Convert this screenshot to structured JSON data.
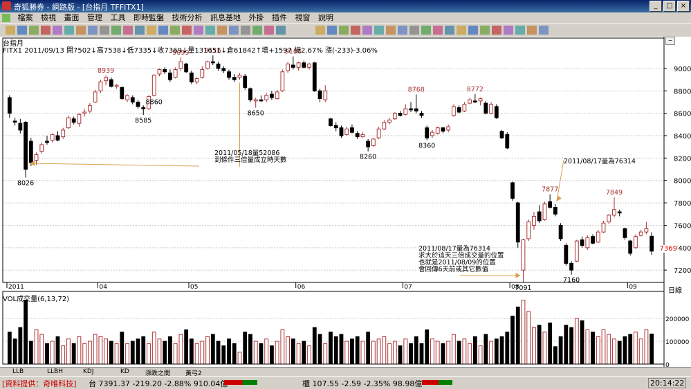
{
  "window": {
    "title": "奇狐勝券 - 網路版 - [台指月 TFFITX1]",
    "controls": [
      "_",
      "□",
      "×"
    ]
  },
  "menu": [
    "檔案",
    "檢視",
    "畫面",
    "管理",
    "工具",
    "即時監盤",
    "技術分析",
    "訊息基地",
    "外掛",
    "插件",
    "視窗",
    "說明"
  ],
  "chart_header": {
    "title": "台指月",
    "info": "FITX1 2011/09/13 開7502↓高7538↓低7335↓收7369↓量131651↓倉61842↑增+1597 振2.67% 漲(-233)-3.06%"
  },
  "price_axis": {
    "ticks": [
      9000,
      8800,
      8600,
      8400,
      8200,
      8000,
      7800,
      7600,
      7400,
      7200
    ],
    "current_label": "7369",
    "unit_label": "日線"
  },
  "x_axis": {
    "labels": [
      {
        "idx": 0,
        "text": "2011"
      },
      {
        "idx": 17,
        "text": "04"
      },
      {
        "idx": 34,
        "text": "05"
      },
      {
        "idx": 54,
        "text": "06"
      },
      {
        "idx": 74,
        "text": "07"
      },
      {
        "idx": 94,
        "text": "08"
      },
      {
        "idx": 116,
        "text": "09"
      }
    ]
  },
  "volume_panel": {
    "legend": "VOL成交量(6,13,72)",
    "ticks": [
      {
        "value": 200000,
        "label": "200000"
      },
      {
        "value": 100000,
        "label": "100000"
      },
      {
        "value": 0,
        "label": "0"
      }
    ]
  },
  "indicator_tabs": [
    "LLB",
    "LLBH",
    "KDJ",
    "KD",
    "漲跌之間",
    "黃弓2"
  ],
  "status_bar": {
    "provider": "[資料提供：奇唯科技]",
    "taiex": "台 7391.37 -219.20 -2.88% 910.04億",
    "otc": "櫃 107.55 -2.59 -2.35% 98.98億",
    "time": "20:14:22",
    "up_color": "#cc0000",
    "down_color": "#008000"
  },
  "annotations": {
    "note1": [
      "2011/05/18量52086",
      "到條件三倍量成立時天數"
    ],
    "note2": "2011/08/17量為76314",
    "note3": [
      "2011/08/17量為76314",
      "求大於這天三倍成交量的位置",
      "也就是2011/08/09的位置",
      "會回傳6天前或其它數值"
    ]
  },
  "chart_data": {
    "type": "candlestick",
    "title": "台指月",
    "ylim": [
      7090,
      9160
    ],
    "volume_ylim": [
      0,
      300000
    ],
    "up_color": "#aa3333",
    "down_color": "#000000",
    "candles": [
      {
        "o": 8740,
        "h": 8760,
        "l": 8560,
        "c": 8600,
        "v": 140000
      },
      {
        "o": 8530,
        "h": 8560,
        "l": 8490,
        "c": 8520,
        "v": 110000
      },
      {
        "o": 8510,
        "h": 8550,
        "l": 8420,
        "c": 8450,
        "v": 160000
      },
      {
        "o": 8520,
        "h": 8530,
        "l": 8026,
        "c": 8100,
        "v": 280000
      },
      {
        "o": 8350,
        "h": 8380,
        "l": 8130,
        "c": 8160,
        "v": 100000
      },
      {
        "o": 8180,
        "h": 8250,
        "l": 8140,
        "c": 8230,
        "v": 150000
      },
      {
        "o": 8260,
        "h": 8340,
        "l": 8240,
        "c": 8320,
        "v": 130000
      },
      {
        "o": 8350,
        "h": 8400,
        "l": 8320,
        "c": 8340,
        "v": 90000
      },
      {
        "o": 8360,
        "h": 8420,
        "l": 8340,
        "c": 8410,
        "v": 100000
      },
      {
        "o": 8400,
        "h": 8440,
        "l": 8350,
        "c": 8360,
        "v": 120000
      },
      {
        "o": 8390,
        "h": 8470,
        "l": 8370,
        "c": 8450,
        "v": 80000
      },
      {
        "o": 8470,
        "h": 8580,
        "l": 8460,
        "c": 8560,
        "v": 110000
      },
      {
        "o": 8550,
        "h": 8570,
        "l": 8500,
        "c": 8520,
        "v": 90000
      },
      {
        "o": 8510,
        "h": 8600,
        "l": 8480,
        "c": 8590,
        "v": 120000
      },
      {
        "o": 8600,
        "h": 8640,
        "l": 8570,
        "c": 8610,
        "v": 90000
      },
      {
        "o": 8620,
        "h": 8690,
        "l": 8600,
        "c": 8670,
        "v": 100000
      },
      {
        "o": 8700,
        "h": 8810,
        "l": 8690,
        "c": 8790,
        "v": 130000
      },
      {
        "o": 8800,
        "h": 8900,
        "l": 8780,
        "c": 8880,
        "v": 120000
      },
      {
        "o": 8890,
        "h": 8939,
        "l": 8850,
        "c": 8920,
        "v": 110000
      },
      {
        "o": 8900,
        "h": 8920,
        "l": 8830,
        "c": 8840,
        "v": 100000
      },
      {
        "o": 8840,
        "h": 8860,
        "l": 8820,
        "c": 8850,
        "v": 90000
      },
      {
        "o": 8830,
        "h": 8840,
        "l": 8720,
        "c": 8730,
        "v": 140000
      },
      {
        "o": 8720,
        "h": 8770,
        "l": 8700,
        "c": 8760,
        "v": 90000
      },
      {
        "o": 8740,
        "h": 8760,
        "l": 8680,
        "c": 8700,
        "v": 100000
      },
      {
        "o": 8700,
        "h": 8720,
        "l": 8640,
        "c": 8660,
        "v": 110000
      },
      {
        "o": 8650,
        "h": 8670,
        "l": 8585,
        "c": 8640,
        "v": 120000
      },
      {
        "o": 8640,
        "h": 8760,
        "l": 8630,
        "c": 8750,
        "v": 90000
      },
      {
        "o": 8760,
        "h": 8950,
        "l": 8750,
        "c": 8940,
        "v": 140000
      },
      {
        "o": 8950,
        "h": 9000,
        "l": 8930,
        "c": 8990,
        "v": 110000
      },
      {
        "o": 8990,
        "h": 9010,
        "l": 8950,
        "c": 8970,
        "v": 100000
      },
      {
        "o": 8960,
        "h": 8990,
        "l": 8880,
        "c": 8900,
        "v": 120000
      },
      {
        "o": 8920,
        "h": 9010,
        "l": 8910,
        "c": 8990,
        "v": 90000
      },
      {
        "o": 9000,
        "h": 9099,
        "l": 8980,
        "c": 9060,
        "v": 130000
      },
      {
        "o": 9040,
        "h": 9050,
        "l": 8960,
        "c": 8970,
        "v": 150000
      },
      {
        "o": 8960,
        "h": 8980,
        "l": 8860,
        "c": 8880,
        "v": 110000
      },
      {
        "o": 8880,
        "h": 8920,
        "l": 8860,
        "c": 8910,
        "v": 90000
      },
      {
        "o": 8920,
        "h": 9020,
        "l": 8910,
        "c": 8990,
        "v": 100000
      },
      {
        "o": 9000,
        "h": 9070,
        "l": 8990,
        "c": 9060,
        "v": 120000
      },
      {
        "o": 9060,
        "h": 9116,
        "l": 9030,
        "c": 9050,
        "v": 130000
      },
      {
        "o": 9040,
        "h": 9060,
        "l": 8980,
        "c": 9000,
        "v": 100000
      },
      {
        "o": 9000,
        "h": 9020,
        "l": 8960,
        "c": 8980,
        "v": 80000
      },
      {
        "o": 8970,
        "h": 8990,
        "l": 8900,
        "c": 8920,
        "v": 110000
      },
      {
        "o": 8920,
        "h": 8950,
        "l": 8880,
        "c": 8900,
        "v": 90000
      },
      {
        "o": 8920,
        "h": 8960,
        "l": 8900,
        "c": 8940,
        "v": 52086
      },
      {
        "o": 8930,
        "h": 8950,
        "l": 8810,
        "c": 8830,
        "v": 140000
      },
      {
        "o": 8820,
        "h": 8830,
        "l": 8700,
        "c": 8720,
        "v": 130000
      },
      {
        "o": 8710,
        "h": 8740,
        "l": 8650,
        "c": 8720,
        "v": 100000
      },
      {
        "o": 8720,
        "h": 8760,
        "l": 8700,
        "c": 8710,
        "v": 90000
      },
      {
        "o": 8720,
        "h": 8780,
        "l": 8700,
        "c": 8760,
        "v": 110000
      },
      {
        "o": 8770,
        "h": 8800,
        "l": 8720,
        "c": 8740,
        "v": 80000
      },
      {
        "o": 8730,
        "h": 8810,
        "l": 8720,
        "c": 8790,
        "v": 100000
      },
      {
        "o": 8800,
        "h": 8990,
        "l": 8790,
        "c": 8970,
        "v": 150000
      },
      {
        "o": 8980,
        "h": 9060,
        "l": 8960,
        "c": 9040,
        "v": 120000
      },
      {
        "o": 9030,
        "h": 9106,
        "l": 8990,
        "c": 9010,
        "v": 110000
      },
      {
        "o": 9010,
        "h": 9060,
        "l": 8980,
        "c": 9050,
        "v": 90000
      },
      {
        "o": 9050,
        "h": 9070,
        "l": 9000,
        "c": 9010,
        "v": 100000
      },
      {
        "o": 9010,
        "h": 9050,
        "l": 8990,
        "c": 9040,
        "v": 80000
      },
      {
        "o": 9050,
        "h": 9060,
        "l": 8790,
        "c": 8800,
        "v": 160000
      },
      {
        "o": 8800,
        "h": 8820,
        "l": 8700,
        "c": 8730,
        "v": 130000
      },
      {
        "o": 8720,
        "h": 8850,
        "l": 8700,
        "c": 8800,
        "v": 90000
      },
      {
        "o": 8550,
        "h": 8560,
        "l": 8480,
        "c": 8490,
        "v": 140000
      },
      {
        "o": 8490,
        "h": 8520,
        "l": 8440,
        "c": 8470,
        "v": 120000
      },
      {
        "o": 8470,
        "h": 8490,
        "l": 8380,
        "c": 8400,
        "v": 130000
      },
      {
        "o": 8410,
        "h": 8480,
        "l": 8400,
        "c": 8460,
        "v": 100000
      },
      {
        "o": 8470,
        "h": 8500,
        "l": 8420,
        "c": 8430,
        "v": 110000
      },
      {
        "o": 8420,
        "h": 8440,
        "l": 8370,
        "c": 8390,
        "v": 120000
      },
      {
        "o": 8390,
        "h": 8430,
        "l": 8380,
        "c": 8410,
        "v": 100000
      },
      {
        "o": 8350,
        "h": 8370,
        "l": 8260,
        "c": 8300,
        "v": 140000
      },
      {
        "o": 8310,
        "h": 8380,
        "l": 8300,
        "c": 8370,
        "v": 100000
      },
      {
        "o": 8380,
        "h": 8480,
        "l": 8370,
        "c": 8460,
        "v": 110000
      },
      {
        "o": 8460,
        "h": 8540,
        "l": 8450,
        "c": 8520,
        "v": 120000
      },
      {
        "o": 8520,
        "h": 8560,
        "l": 8500,
        "c": 8540,
        "v": 90000
      },
      {
        "o": 8550,
        "h": 8610,
        "l": 8540,
        "c": 8600,
        "v": 100000
      },
      {
        "o": 8600,
        "h": 8620,
        "l": 8570,
        "c": 8580,
        "v": 80000
      },
      {
        "o": 8590,
        "h": 8680,
        "l": 8580,
        "c": 8640,
        "v": 110000
      },
      {
        "o": 8640,
        "h": 8700,
        "l": 8610,
        "c": 8630,
        "v": 90000
      },
      {
        "o": 8640,
        "h": 8768,
        "l": 8600,
        "c": 8620,
        "v": 120000
      },
      {
        "o": 8600,
        "h": 8620,
        "l": 8560,
        "c": 8580,
        "v": 90000
      },
      {
        "o": 8470,
        "h": 8490,
        "l": 8360,
        "c": 8380,
        "v": 150000
      },
      {
        "o": 8400,
        "h": 8450,
        "l": 8380,
        "c": 8430,
        "v": 110000
      },
      {
        "o": 8420,
        "h": 8480,
        "l": 8410,
        "c": 8470,
        "v": 100000
      },
      {
        "o": 8470,
        "h": 8480,
        "l": 8420,
        "c": 8440,
        "v": 90000
      },
      {
        "o": 8450,
        "h": 8500,
        "l": 8430,
        "c": 8480,
        "v": 100000
      },
      {
        "o": 8580,
        "h": 8680,
        "l": 8570,
        "c": 8660,
        "v": 130000
      },
      {
        "o": 8650,
        "h": 8670,
        "l": 8600,
        "c": 8610,
        "v": 100000
      },
      {
        "o": 8620,
        "h": 8700,
        "l": 8610,
        "c": 8680,
        "v": 110000
      },
      {
        "o": 8690,
        "h": 8740,
        "l": 8680,
        "c": 8720,
        "v": 90000
      },
      {
        "o": 8710,
        "h": 8772,
        "l": 8690,
        "c": 8700,
        "v": 120000
      },
      {
        "o": 8710,
        "h": 8740,
        "l": 8670,
        "c": 8730,
        "v": 80000
      },
      {
        "o": 8690,
        "h": 8710,
        "l": 8590,
        "c": 8600,
        "v": 130000
      },
      {
        "o": 8600,
        "h": 8700,
        "l": 8590,
        "c": 8680,
        "v": 100000
      },
      {
        "o": 8660,
        "h": 8680,
        "l": 8550,
        "c": 8560,
        "v": 110000
      },
      {
        "o": 8440,
        "h": 8450,
        "l": 8370,
        "c": 8380,
        "v": 120000
      },
      {
        "o": 8410,
        "h": 8430,
        "l": 8280,
        "c": 8290,
        "v": 140000
      },
      {
        "o": 7980,
        "h": 7990,
        "l": 7820,
        "c": 7840,
        "v": 210000
      },
      {
        "o": 7800,
        "h": 7810,
        "l": 7400,
        "c": 7450,
        "v": 250000
      },
      {
        "o": 7200,
        "h": 7480,
        "l": 7091,
        "c": 7470,
        "v": 280000
      },
      {
        "o": 7480,
        "h": 7650,
        "l": 7460,
        "c": 7630,
        "v": 230000
      },
      {
        "o": 7600,
        "h": 7720,
        "l": 7560,
        "c": 7680,
        "v": 160000
      },
      {
        "o": 7720,
        "h": 7780,
        "l": 7620,
        "c": 7640,
        "v": 170000
      },
      {
        "o": 7650,
        "h": 7810,
        "l": 7640,
        "c": 7790,
        "v": 140000
      },
      {
        "o": 7810,
        "h": 7877,
        "l": 7750,
        "c": 7760,
        "v": 180000
      },
      {
        "o": 7760,
        "h": 7790,
        "l": 7680,
        "c": 7700,
        "v": 76314
      },
      {
        "o": 7600,
        "h": 7620,
        "l": 7460,
        "c": 7480,
        "v": 120000
      },
      {
        "o": 7420,
        "h": 7440,
        "l": 7240,
        "c": 7260,
        "v": 170000
      },
      {
        "o": 7260,
        "h": 7280,
        "l": 7160,
        "c": 7200,
        "v": 160000
      },
      {
        "o": 7280,
        "h": 7470,
        "l": 7270,
        "c": 7460,
        "v": 200000
      },
      {
        "o": 7470,
        "h": 7500,
        "l": 7400,
        "c": 7420,
        "v": 190000
      },
      {
        "o": 7400,
        "h": 7510,
        "l": 7380,
        "c": 7490,
        "v": 150000
      },
      {
        "o": 7500,
        "h": 7520,
        "l": 7430,
        "c": 7440,
        "v": 140000
      },
      {
        "o": 7450,
        "h": 7560,
        "l": 7440,
        "c": 7540,
        "v": 120000
      },
      {
        "o": 7540,
        "h": 7640,
        "l": 7530,
        "c": 7620,
        "v": 150000
      },
      {
        "o": 7630,
        "h": 7700,
        "l": 7610,
        "c": 7690,
        "v": 130000
      },
      {
        "o": 7690,
        "h": 7849,
        "l": 7670,
        "c": 7740,
        "v": 110000
      },
      {
        "o": 7720,
        "h": 7740,
        "l": 7680,
        "c": 7710,
        "v": 100000
      },
      {
        "o": 7570,
        "h": 7580,
        "l": 7470,
        "c": 7490,
        "v": 120000
      },
      {
        "o": 7460,
        "h": 7470,
        "l": 7330,
        "c": 7350,
        "v": 130000
      },
      {
        "o": 7400,
        "h": 7520,
        "l": 7390,
        "c": 7500,
        "v": 140000
      },
      {
        "o": 7510,
        "h": 7560,
        "l": 7500,
        "c": 7540,
        "v": 110000
      },
      {
        "o": 7540,
        "h": 7630,
        "l": 7520,
        "c": 7570,
        "v": 150000
      },
      {
        "o": 7502,
        "h": 7538,
        "l": 7335,
        "c": 7369,
        "v": 131651
      }
    ],
    "labels": [
      {
        "idx": 3,
        "text": "8026",
        "at": "low"
      },
      {
        "idx": 18,
        "text": "8939",
        "at": "high"
      },
      {
        "idx": 25,
        "text": "8585",
        "at": "low"
      },
      {
        "idx": 27,
        "text": "8860",
        "at": "low"
      },
      {
        "idx": 32,
        "text": "9099",
        "at": "high"
      },
      {
        "idx": 38,
        "text": "9116",
        "at": "high"
      },
      {
        "idx": 46,
        "text": "8650",
        "at": "low"
      },
      {
        "idx": 53,
        "text": "9106",
        "at": "high"
      },
      {
        "idx": 67,
        "text": "8260",
        "at": "low"
      },
      {
        "idx": 76,
        "text": "8768",
        "at": "high"
      },
      {
        "idx": 78,
        "text": "8360",
        "at": "low"
      },
      {
        "idx": 87,
        "text": "8772",
        "at": "high"
      },
      {
        "idx": 96,
        "text": "7091",
        "at": "low"
      },
      {
        "idx": 101,
        "text": "7877",
        "at": "high"
      },
      {
        "idx": 105,
        "text": "7160",
        "at": "low"
      },
      {
        "idx": 113,
        "text": "7849",
        "at": "high"
      }
    ]
  }
}
